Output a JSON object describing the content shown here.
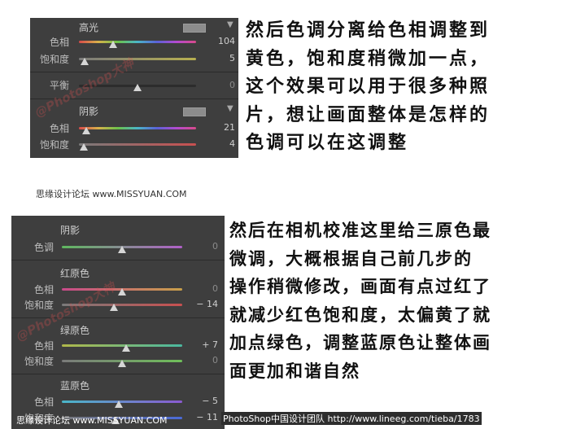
{
  "panel1": {
    "highlights": {
      "title": "高光",
      "hue_label": "色相",
      "hue_value": "104",
      "hue_level": 0.29,
      "sat_label": "饱和度",
      "sat_value": "5",
      "sat_level": 0.05
    },
    "balance": {
      "label": "平衡",
      "value": "0",
      "level": 0.5
    },
    "shadows": {
      "title": "阴影",
      "hue_label": "色相",
      "hue_value": "21",
      "hue_level": 0.06,
      "sat_label": "饱和度",
      "sat_value": "4",
      "sat_level": 0.04
    }
  },
  "panel2": {
    "shadows": {
      "title": "阴影",
      "tint_label": "色调",
      "tint_value": "0",
      "tint_level": 0.5
    },
    "red": {
      "title": "红原色",
      "hue_label": "色相",
      "hue_value": "0",
      "hue_level": 0.5,
      "sat_label": "饱和度",
      "sat_value": "− 14",
      "sat_level": 0.43
    },
    "green": {
      "title": "绿原色",
      "hue_label": "色相",
      "hue_value": "+ 7",
      "hue_level": 0.535,
      "sat_label": "饱和度",
      "sat_value": "0",
      "sat_level": 0.5
    },
    "blue": {
      "title": "蓝原色",
      "hue_label": "色相",
      "hue_value": "− 5",
      "hue_level": 0.475,
      "sat_label": "饱和度",
      "sat_value": "− 11",
      "sat_level": 0.445
    }
  },
  "watermark": "@Photoshop大神",
  "caption1": "思缘设计论坛 www.MISSYUAN.COM",
  "caption2": "思缘设计论坛 www.MISSYUAN.COM",
  "footer_credit": "PhotoShop中国设计团队 http://www.lineeg.com/tieba/1783",
  "text1": [
    "然后色调分离给色相调整到",
    "黄色，饱和度稍微加一点，",
    "这个效果可以用于很多种照",
    "片，想让画面整体是怎样的",
    "色调可以在这调整"
  ],
  "text2": [
    "然后在相机校准这里给三原色最",
    "微调，大概根据自己前几步的",
    "操作稍微修改，画面有点过红了",
    "就减少红色饱和度，太偏黄了就",
    "加点绿色，调整蓝原色让整体画",
    "面更加和谐自然"
  ]
}
